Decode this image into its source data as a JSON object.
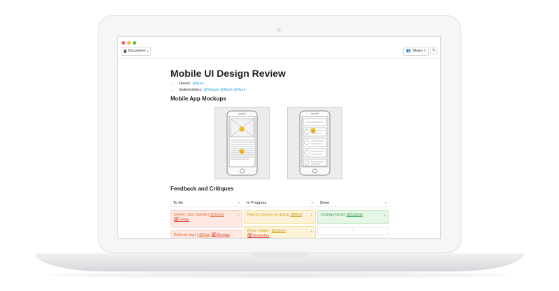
{
  "toolbar": {
    "doc_menu_label": "Document",
    "share_label": "Share",
    "share_count": "6"
  },
  "document": {
    "title": "Mobile UI Design Review",
    "owner_label": "Owner:",
    "owner_mention": "@Mari",
    "stakeholders_label": "Stakeholders:",
    "stakeholders_mentions": "@Megan @Mark @April"
  },
  "sections": {
    "mockups_heading": "Mobile App Mockups",
    "feedback_heading": "Feedback and Critiques"
  },
  "mockup_markers": [
    "1",
    "2",
    "3"
  ],
  "board": {
    "columns": [
      {
        "label": "To Do"
      },
      {
        "label": "In Progress"
      },
      {
        "label": "Done"
      }
    ],
    "cards": {
      "todo1": {
        "title": "Define color palette | ",
        "assignee": "@Jason",
        "due": "🗓Today"
      },
      "todo2": {
        "title": "Refresh logo | ",
        "assignee": "@Mari",
        "due": "🗓Monday"
      },
      "prog1": {
        "title": "Round corners on dialog ",
        "assignee": "@Mari",
        "due": ""
      },
      "prog2": {
        "title": "Move image | ",
        "assignee": "@Jason",
        "due": "🗓Yesterday"
      },
      "done1": {
        "title": "Change fonts | ",
        "assignee": "@Camila",
        "due": ""
      }
    },
    "add_card_label": "+"
  },
  "colors": {
    "orange_card": "#fde9e2",
    "yellow_card": "#fdf3d8",
    "green_card": "#e5f6e6",
    "mention": "#3aa3dc",
    "marker": "#f4c430"
  },
  "icons": [
    "document-icon",
    "people-icon",
    "edit-icon",
    "chevron-down-icon",
    "add-icon"
  ]
}
